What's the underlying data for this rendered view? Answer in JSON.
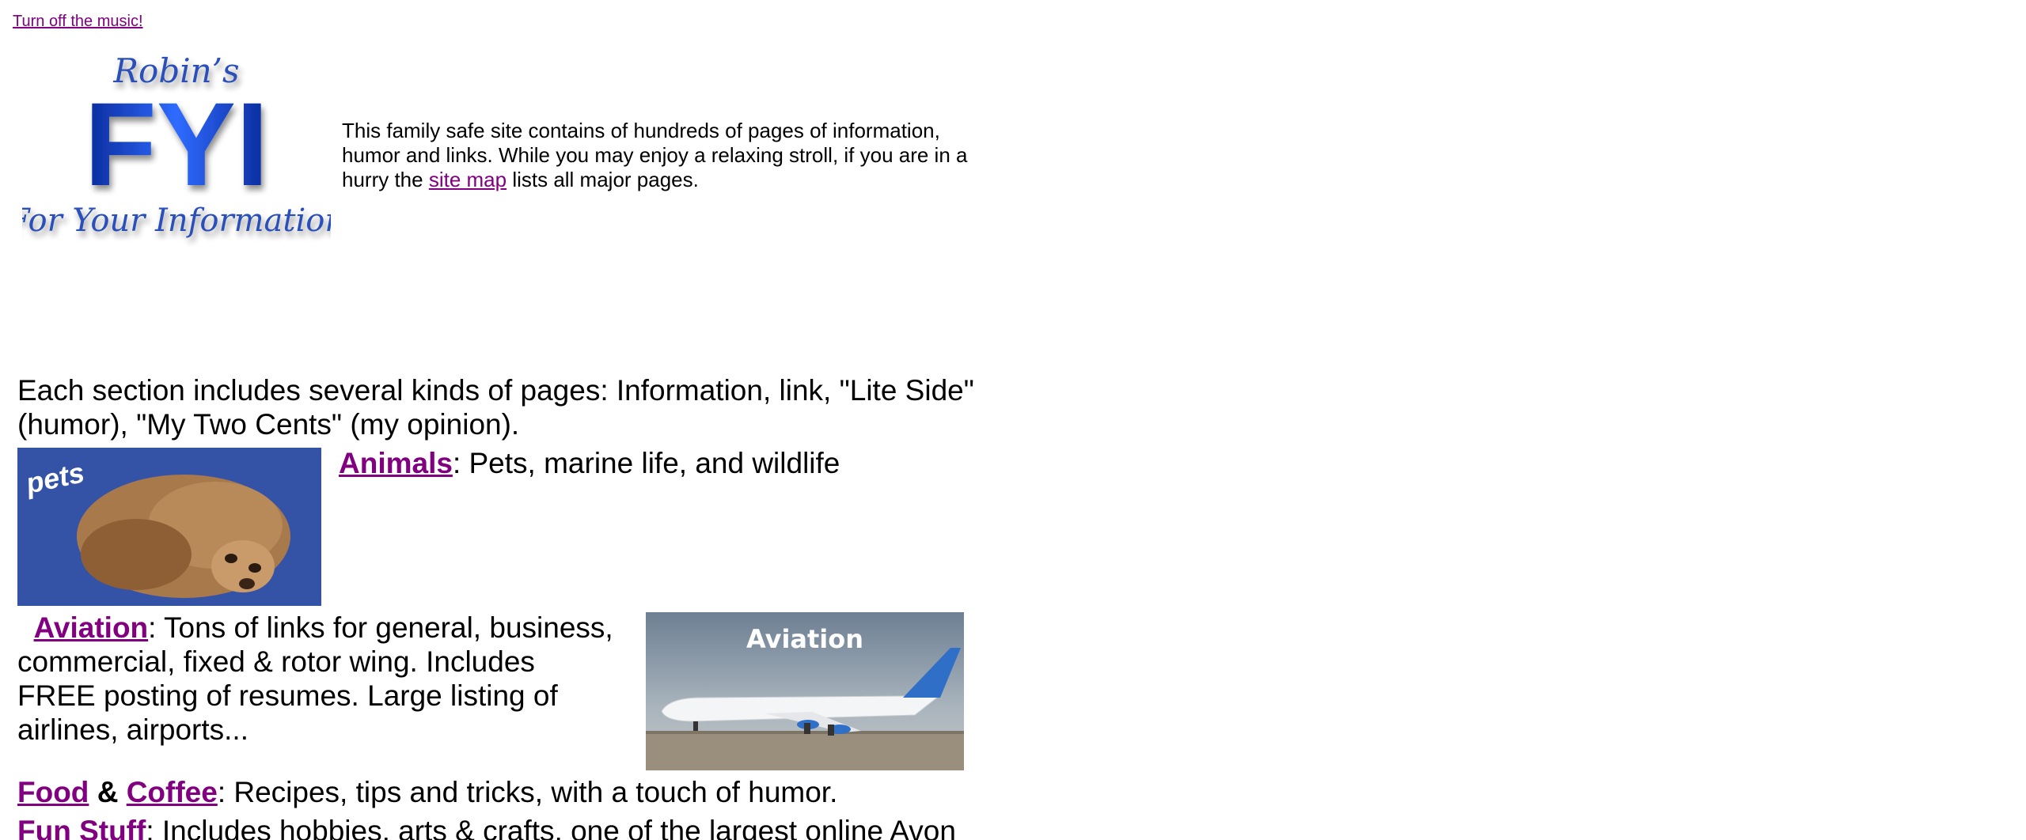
{
  "header": {
    "music_link": "Turn off the music!"
  },
  "logo": {
    "line1": "Robin's",
    "line2": "FYI",
    "line3": "For Your Information"
  },
  "intro": {
    "text_before": "This family safe site contains of hundreds of pages of information, humor and links. While you may enjoy a relaxing stroll, if you are in a hurry the ",
    "link": "site map",
    "text_after": " lists all major pages."
  },
  "sections": {
    "intro": "Each section includes several kinds of pages: Information, link, \"Lite Side\" (humor), \"My Two Cents\" (my opinion).",
    "animals": {
      "image_label": "pets",
      "link": "Animals",
      "text": ": Pets, marine life, and wildlife"
    },
    "aviation": {
      "link": "Aviation",
      "text": ": Tons of links for general, business, commercial, fixed & rotor wing. Includes FREE posting of resumes. Large listing of airlines, airports...",
      "image_label": "Aviation"
    },
    "food": {
      "link1": "Food",
      "amp": "&",
      "link2": "Coffee",
      "text": ": Recipes, tips and tricks, with a touch of humor."
    },
    "fun": {
      "link": "Fun Stuff",
      "text": ": Includes hobbies, arts & crafts, one of the largest online Avon"
    }
  },
  "colors": {
    "link": "#800080",
    "logo_blue": "#1a3fb0",
    "pets_bg": "#3553a6"
  }
}
